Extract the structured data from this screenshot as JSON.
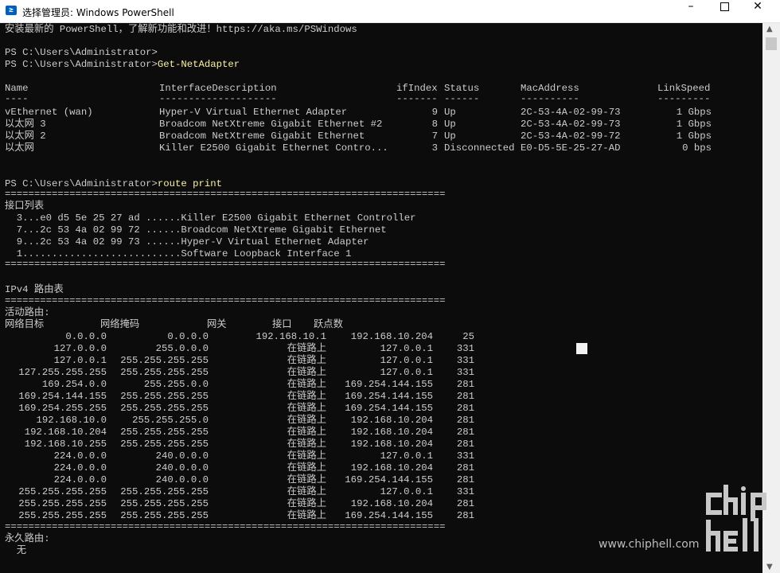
{
  "window": {
    "title": "选择管理员: Windows PowerShell",
    "icon_glyph": "≥",
    "controls": {
      "minimize": "–",
      "maximize": "",
      "close": "✕"
    }
  },
  "console": {
    "intro": "安装最新的 PowerShell，了解新功能和改进！https://aka.ms/PSWindows",
    "prompt_blank": "PS C:\\Users\\Administrator>",
    "prompt1": "PS C:\\Users\\Administrator>",
    "cmd1": "Get-NetAdapter",
    "adapter_headers": [
      "Name",
      "InterfaceDescription",
      "ifIndex",
      "Status",
      "MacAddress",
      "LinkSpeed"
    ],
    "adapter_dashes": [
      "----",
      "--------------------",
      "-------",
      "------",
      "----------",
      "---------"
    ],
    "adapters": [
      {
        "name": "vEthernet (wan)",
        "desc": "Hyper-V Virtual Ethernet Adapter",
        "ifindex": "9",
        "status": "Up",
        "mac": "2C-53-4A-02-99-73",
        "speed": "1 Gbps"
      },
      {
        "name": "以太网 3",
        "desc": "Broadcom NetXtreme Gigabit Ethernet #2",
        "ifindex": "8",
        "status": "Up",
        "mac": "2C-53-4A-02-99-73",
        "speed": "1 Gbps"
      },
      {
        "name": "以太网 2",
        "desc": "Broadcom NetXtreme Gigabit Ethernet",
        "ifindex": "7",
        "status": "Up",
        "mac": "2C-53-4A-02-99-72",
        "speed": "1 Gbps"
      },
      {
        "name": "以太网",
        "desc": "Killer E2500 Gigabit Ethernet Contro...",
        "ifindex": "3",
        "status": "Disconnected",
        "mac": "E0-D5-5E-25-27-AD",
        "speed": "0 bps"
      }
    ],
    "prompt2": "PS C:\\Users\\Administrator>",
    "cmd2": "route print",
    "separator": "===========================================================================",
    "interface_list_title": "接口列表",
    "interfaces": [
      "  3...e0 d5 5e 25 27 ad ......Killer E2500 Gigabit Ethernet Controller",
      "  7...2c 53 4a 02 99 72 ......Broadcom NetXtreme Gigabit Ethernet",
      "  9...2c 53 4a 02 99 73 ......Hyper-V Virtual Ethernet Adapter",
      "  1...........................Software Loopback Interface 1"
    ],
    "ipv4_title": "IPv4 路由表",
    "active_routes_title": "活动路由:",
    "route_headers": [
      "网络目标",
      "网络掩码",
      "网关",
      "接口",
      "跃点数"
    ],
    "routes": [
      {
        "dest": "0.0.0.0",
        "mask": "0.0.0.0",
        "gw": "192.168.10.1",
        "iface": "192.168.10.204",
        "metric": "25"
      },
      {
        "dest": "127.0.0.0",
        "mask": "255.0.0.0",
        "gw": "在链路上",
        "iface": "127.0.0.1",
        "metric": "331"
      },
      {
        "dest": "127.0.0.1",
        "mask": "255.255.255.255",
        "gw": "在链路上",
        "iface": "127.0.0.1",
        "metric": "331"
      },
      {
        "dest": "127.255.255.255",
        "mask": "255.255.255.255",
        "gw": "在链路上",
        "iface": "127.0.0.1",
        "metric": "331"
      },
      {
        "dest": "169.254.0.0",
        "mask": "255.255.0.0",
        "gw": "在链路上",
        "iface": "169.254.144.155",
        "metric": "281"
      },
      {
        "dest": "169.254.144.155",
        "mask": "255.255.255.255",
        "gw": "在链路上",
        "iface": "169.254.144.155",
        "metric": "281"
      },
      {
        "dest": "169.254.255.255",
        "mask": "255.255.255.255",
        "gw": "在链路上",
        "iface": "169.254.144.155",
        "metric": "281"
      },
      {
        "dest": "192.168.10.0",
        "mask": "255.255.255.0",
        "gw": "在链路上",
        "iface": "192.168.10.204",
        "metric": "281"
      },
      {
        "dest": "192.168.10.204",
        "mask": "255.255.255.255",
        "gw": "在链路上",
        "iface": "192.168.10.204",
        "metric": "281"
      },
      {
        "dest": "192.168.10.255",
        "mask": "255.255.255.255",
        "gw": "在链路上",
        "iface": "192.168.10.204",
        "metric": "281"
      },
      {
        "dest": "224.0.0.0",
        "mask": "240.0.0.0",
        "gw": "在链路上",
        "iface": "127.0.0.1",
        "metric": "331"
      },
      {
        "dest": "224.0.0.0",
        "mask": "240.0.0.0",
        "gw": "在链路上",
        "iface": "192.168.10.204",
        "metric": "281"
      },
      {
        "dest": "224.0.0.0",
        "mask": "240.0.0.0",
        "gw": "在链路上",
        "iface": "169.254.144.155",
        "metric": "281"
      },
      {
        "dest": "255.255.255.255",
        "mask": "255.255.255.255",
        "gw": "在链路上",
        "iface": "127.0.0.1",
        "metric": "331"
      },
      {
        "dest": "255.255.255.255",
        "mask": "255.255.255.255",
        "gw": "在链路上",
        "iface": "192.168.10.204",
        "metric": "281"
      },
      {
        "dest": "255.255.255.255",
        "mask": "255.255.255.255",
        "gw": "在链路上",
        "iface": "169.254.144.155",
        "metric": "281"
      }
    ],
    "persistent_routes_title": "永久路由:",
    "persistent_none": "  无"
  },
  "watermark": {
    "url": "www.chiphell.com",
    "logo_text": "chiphell",
    "logo_color": "#c8c8c8"
  },
  "colors": {
    "console_bg": "#0c0c0c",
    "console_fg": "#cccccc",
    "command_fg": "#f9f1a5"
  },
  "icons": {
    "app": "powershell-icon",
    "scroll_up": "scroll-up-arrow-icon",
    "scroll_down": "scroll-down-arrow-icon"
  }
}
